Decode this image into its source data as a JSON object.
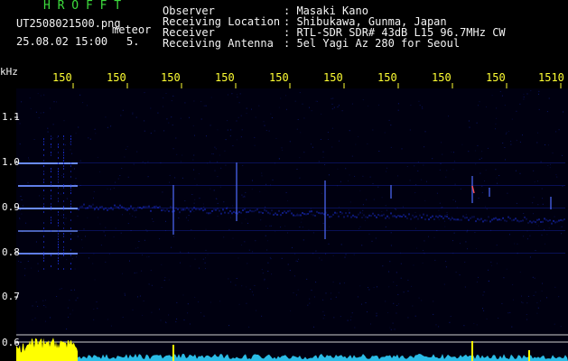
{
  "header": {
    "logo": "H R O F F T",
    "filename": "UT2508021500.png",
    "tag": "meteor",
    "datetime": "25.08.02 15:00",
    "count": "5."
  },
  "info": {
    "labels": [
      "Observer",
      "Receiving Location",
      "Receiver",
      "Receiving Antenna"
    ],
    "values": [
      ": Masaki Kano",
      ": Shibukawa, Gunma, Japan",
      ": RTL-SDR SDR# 43dB L15 96.7MHz CW",
      ": 5el Yagi Az 280 for Seoul"
    ]
  },
  "axes": {
    "y_unit": "kHz",
    "y_ticks": [
      "1.1",
      "1.0",
      "0.9",
      "0.8",
      "0.7",
      "0.6"
    ],
    "x_ticks": [
      "150",
      "150",
      "150",
      "150",
      "150",
      "150",
      "150",
      "150",
      "150",
      "1510"
    ]
  },
  "colors": {
    "header_green": "#3ddc3d",
    "tick_yellow": "#ffff33",
    "background": "#000000",
    "spectrum_blue": "#1a2fd6",
    "meteor_cyan": "#2fd0ff",
    "level_yellow": "#ffff00"
  }
}
